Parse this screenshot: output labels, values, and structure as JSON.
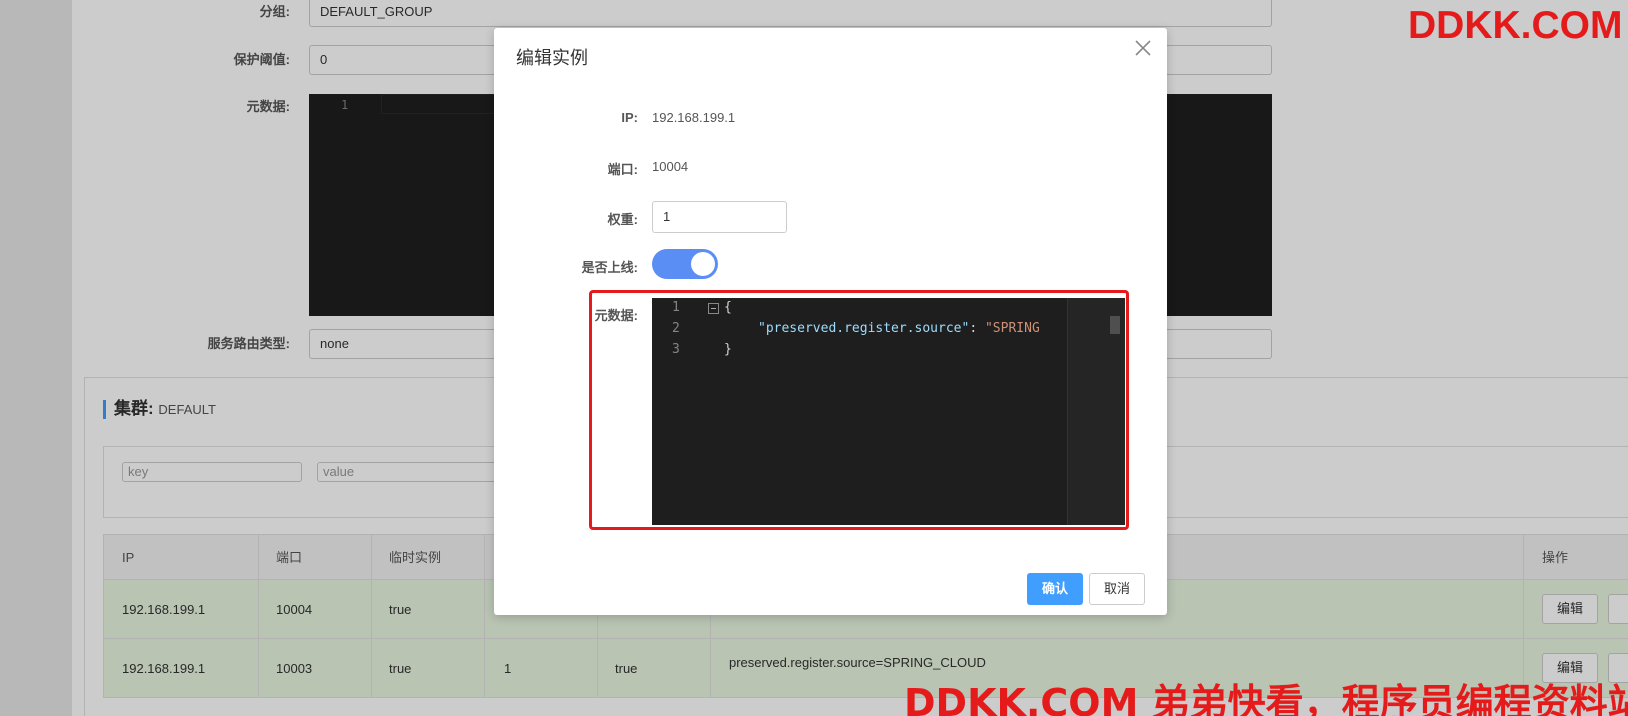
{
  "background_form": {
    "group_label": "分组:",
    "group_value": "DEFAULT_GROUP",
    "threshold_label": "保护阈值:",
    "threshold_value": "0",
    "metadata_label": "元数据:",
    "metadata_line_number": "1",
    "route_label": "服务路由类型:",
    "route_value": "none"
  },
  "cluster": {
    "title": "集群:",
    "name": "DEFAULT",
    "key_placeholder": "key",
    "value_placeholder": "value"
  },
  "table": {
    "headers": [
      "IP",
      "端口",
      "临时实例",
      "操作"
    ],
    "rows": [
      {
        "ip": "192.168.199.1",
        "port": "10004",
        "ephemeral": "true",
        "weight": "",
        "healthy": "",
        "metadata": "",
        "edit": "编辑"
      },
      {
        "ip": "192.168.199.1",
        "port": "10003",
        "ephemeral": "true",
        "weight": "1",
        "healthy": "true",
        "metadata": "preserved.register.source=SPRING_CLOUD",
        "edit": "编辑"
      }
    ]
  },
  "modal": {
    "title": "编辑实例",
    "ip_label": "IP:",
    "ip_value": "192.168.199.1",
    "port_label": "端口:",
    "port_value": "10004",
    "weight_label": "权重:",
    "weight_value": "1",
    "online_label": "是否上线:",
    "online_on": true,
    "metadata_label": "元数据:",
    "code_lines": [
      {
        "n": "1",
        "text": "{"
      },
      {
        "n": "2",
        "key": "\"preserved.register.source\"",
        "sep": ": ",
        "val": "\"SPRING"
      },
      {
        "n": "3",
        "text": "}"
      }
    ],
    "confirm": "确认",
    "cancel": "取消"
  },
  "watermark": {
    "top": "DDKK.COM",
    "bottom": "DDKK.COM 弟弟快看，程序员编程资料站"
  },
  "colors": {
    "accent": "#409eff",
    "switch_on": "#5b8ef5",
    "highlight": "#e51b1b",
    "row_bg": "#e8f5e0"
  }
}
